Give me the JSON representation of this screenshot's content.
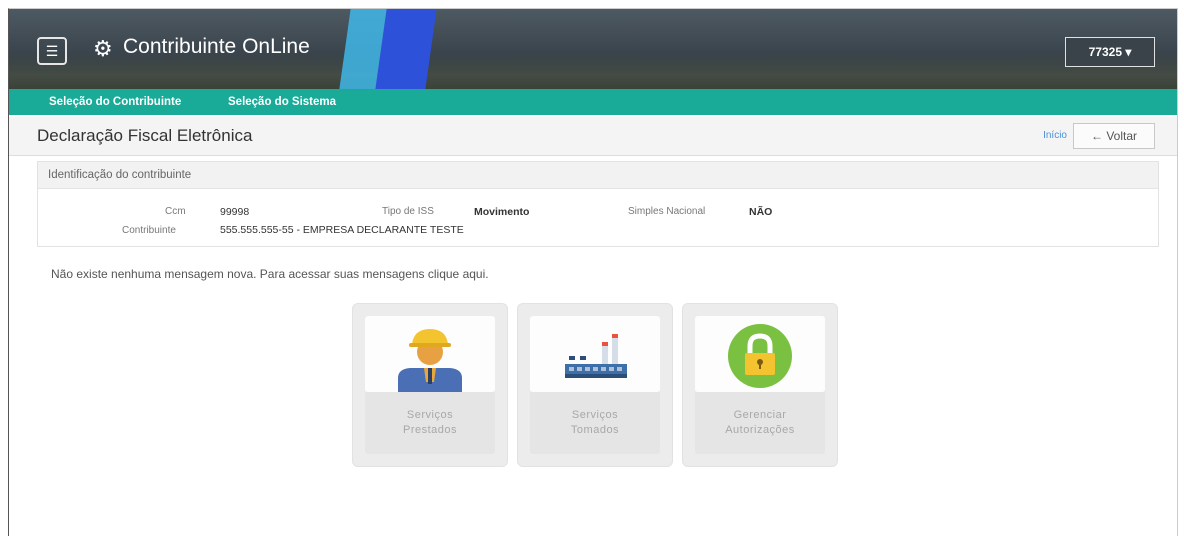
{
  "header": {
    "app_title": "Contribuinte OnLine",
    "menu_icon": "menu-icon",
    "app_icon": "gear-icon",
    "user_code": "77325",
    "user_caret": "▾"
  },
  "nav": {
    "items": [
      {
        "label": "Seleção do Contribuinte"
      },
      {
        "label": "Seleção do Sistema"
      }
    ]
  },
  "page": {
    "title": "Declaração Fiscal Eletrônica",
    "inicio_label": "Início",
    "back_label": "← Voltar"
  },
  "identification": {
    "panel_title": "Identificação do contribuinte",
    "ccm_label": "Ccm",
    "ccm_value": "99998",
    "tipo_iss_label": "Tipo de ISS",
    "tipo_iss_value": "Movimento",
    "simples_label": "Simples Nacional",
    "simples_value": "NÃO",
    "contribuinte_label": "Contribuinte",
    "contribuinte_value": "555.555.555-55 - EMPRESA DECLARANTE TESTE"
  },
  "message": "Não existe nenhuma mensagem nova. Para acessar suas mensagens clique aqui.",
  "tiles": [
    {
      "line1": "Serviços",
      "line2": "Prestados",
      "icon": "worker-icon"
    },
    {
      "line1": "Serviços",
      "line2": "Tomados",
      "icon": "factory-icon"
    },
    {
      "line1": "Gerenciar",
      "line2": "Autorizações",
      "icon": "lock-icon"
    }
  ],
  "colors": {
    "nav_teal": "#1aab98",
    "accent_blue": "#2d52d9",
    "lock_green": "#7ac142"
  }
}
